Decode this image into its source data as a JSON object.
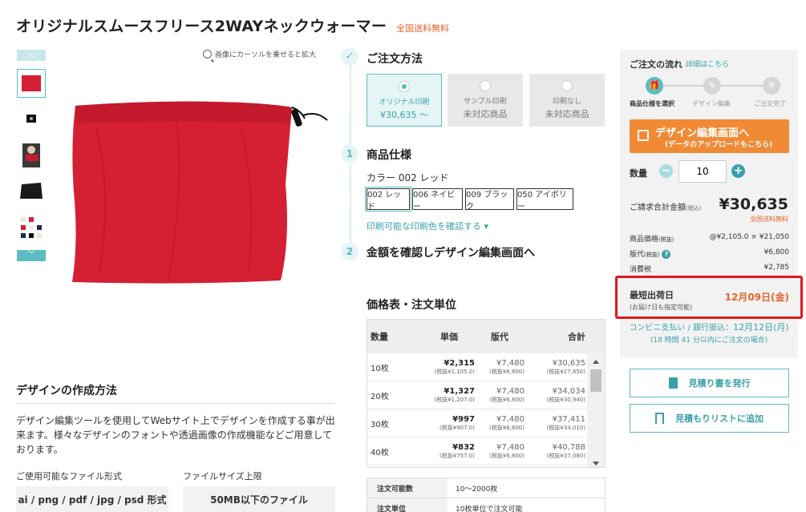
{
  "product": {
    "title": "オリジナルスムースフリース2WAYネックウォーマー",
    "free_shipping": "全国送料無料"
  },
  "gallery": {
    "zoom_hint": "画像にカーソルを乗せると拡大",
    "up_arrow": "︿",
    "down_arrow": "﹀"
  },
  "design": {
    "heading": "デザインの作成方法",
    "description": "デザイン編集ツールを使用してWebサイト上でデザインを作成する事が出来ます。様々なデザインのフォントや透過画像の作成機能などご用意しております。",
    "file_types_label": "ご使用可能なファイル形式",
    "file_types_value": "ai / png / pdf / jpg / psd 形式",
    "file_size_label": "ファイルサイズ上限",
    "file_size_value": "50MB以下のファイル"
  },
  "steps": {
    "order_method_title": "ご注文方法",
    "step1_num": "1",
    "step1_title": "商品仕様",
    "step2_num": "2",
    "step2_title": "金額を確認しデザイン編集画面へ",
    "check": "✓"
  },
  "methods": [
    {
      "name": "オリジナル印刷",
      "value": "¥30,635 〜"
    },
    {
      "name": "サンプル印刷",
      "value": "未対応商品"
    },
    {
      "name": "印刷なし",
      "value": "未対応商品"
    }
  ],
  "colors": {
    "label": "カラー  002 レッド",
    "options": [
      "002 レッド",
      "006 ネイビー",
      "009 ブラック",
      "050 アイボリー"
    ],
    "print_link": "印刷可能な印刷色を確認する ▾"
  },
  "price_table": {
    "title": "価格表・注文単位",
    "headers": [
      "数量",
      "単価",
      "版代",
      "合計"
    ],
    "rows": [
      {
        "qty": "10枚",
        "unit": "¥2,315",
        "unit_sub": "(税抜¥2,105.0)",
        "plate": "¥7,480",
        "plate_sub": "(税抜¥6,800)",
        "total": "¥30,635",
        "total_sub": "(税抜¥27,850)"
      },
      {
        "qty": "20枚",
        "unit": "¥1,327",
        "unit_sub": "(税抜¥1,207.0)",
        "plate": "¥7,480",
        "plate_sub": "(税抜¥6,800)",
        "total": "¥34,034",
        "total_sub": "(税抜¥30,940)"
      },
      {
        "qty": "30枚",
        "unit": "¥997",
        "unit_sub": "(税抜¥907.0)",
        "plate": "¥7,480",
        "plate_sub": "(税抜¥6,800)",
        "total": "¥37,411",
        "total_sub": "(税抜¥34,010)"
      },
      {
        "qty": "40枚",
        "unit": "¥832",
        "unit_sub": "(税抜¥757.0)",
        "plate": "¥7,480",
        "plate_sub": "(税抜¥6,800)",
        "total": "¥40,788",
        "total_sub": "(税抜¥37,080)"
      }
    ],
    "info": [
      {
        "k": "注文可能数",
        "v": "10〜2000枚"
      },
      {
        "k": "注文単位",
        "v": "10枚単位で注文可能"
      }
    ]
  },
  "sidebar": {
    "flow_title": "ご注文の流れ",
    "flow_link": "詳細はこちら",
    "flow_steps": [
      "商品仕様を選択",
      "デザイン編集",
      "ご注文完了"
    ],
    "flow_icons": [
      "🎁",
      "✎",
      "¥"
    ],
    "cta_main": "デザイン編集画面へ",
    "cta_sub": "(データのアップロードもこちら)",
    "qty_label": "数量",
    "qty_value": "10",
    "minus": "−",
    "plus": "+",
    "total_label": "ご請求合計金額",
    "total_label_tax": "(税込)",
    "total_value": "¥30,635",
    "total_ship": "全国送料無料",
    "breakdown": [
      {
        "k": "商品価格",
        "k_sub": "(税抜)",
        "v": "@¥2,105.0 × ¥21,050"
      },
      {
        "k": "版代",
        "k_sub": "(税抜)",
        "v": "¥6,800"
      },
      {
        "k": "消費税",
        "k_sub": "",
        "v": "¥2,785"
      }
    ],
    "help": "?",
    "ship_label": "最短出荷日",
    "ship_sub": "(お届け日も指定可能)",
    "ship_date": "12月09日(金)",
    "bank_line": "コンビニ支払い / 銀行振込：",
    "bank_date": "12月12日(月)",
    "bank_note": "(18 時間 41 分以内にご注文の場合)",
    "quote_btn": "見積り書を発行",
    "list_btn": "見積もりリストに追加"
  },
  "colors_theme": {
    "accent": "#5bbcc4",
    "cta": "#f08a35",
    "highlight": "#e0181b",
    "orange_text": "#e8622c",
    "product_red": "#d51f33"
  }
}
